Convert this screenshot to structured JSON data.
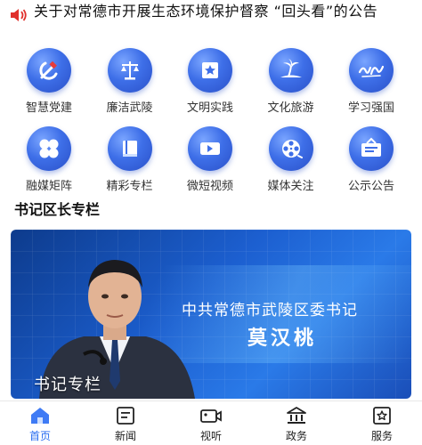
{
  "notice": {
    "icon": "speaker-icon",
    "text": "关于对常德市开展生态环境保护督察 “回头看”的公告"
  },
  "grid": {
    "row1": [
      {
        "label": "智慧党建",
        "icon": "party-emblem-icon"
      },
      {
        "label": "廉洁武陵",
        "icon": "scales-icon"
      },
      {
        "label": "文明实践",
        "icon": "star-flag-icon"
      },
      {
        "label": "文化旅游",
        "icon": "palm-island-icon"
      },
      {
        "label": "学习强国",
        "icon": "study-calligraphy-icon"
      }
    ],
    "row2": [
      {
        "label": "融媒矩阵",
        "icon": "grid-petals-icon"
      },
      {
        "label": "精彩专栏",
        "icon": "book-icon"
      },
      {
        "label": "微短视频",
        "icon": "video-camera-icon"
      },
      {
        "label": "媒体关注",
        "icon": "film-reel-icon"
      },
      {
        "label": "公示公告",
        "icon": "notice-board-icon"
      }
    ]
  },
  "section": {
    "title": "书记区长专栏"
  },
  "banner": {
    "line1": "中共常德市武陵区委书记",
    "line2": "莫汉桃",
    "caption": "书记专栏"
  },
  "tabbar": {
    "items": [
      {
        "label": "首页",
        "icon": "home-icon",
        "active": true
      },
      {
        "label": "新闻",
        "icon": "news-icon"
      },
      {
        "label": "视听",
        "icon": "video-icon"
      },
      {
        "label": "政务",
        "icon": "government-building-icon"
      },
      {
        "label": "服务",
        "icon": "service-star-icon"
      }
    ]
  },
  "colors": {
    "accent": "#2a6ef0",
    "icon_blue": "#3e6fe8",
    "speaker_red": "#e0302c"
  }
}
